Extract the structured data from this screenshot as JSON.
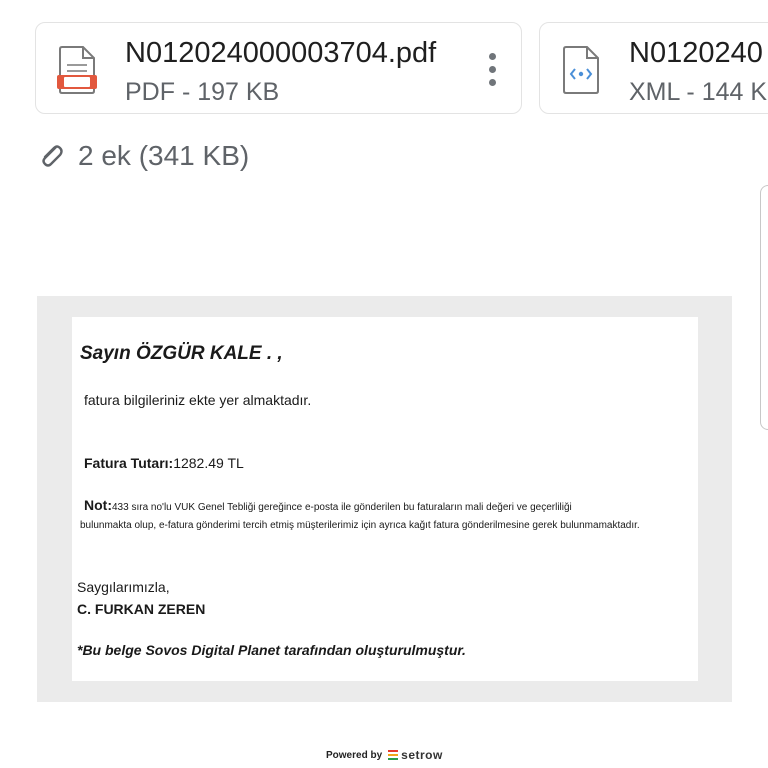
{
  "attachments": [
    {
      "name": "N012024000003704.pdf",
      "meta": "PDF - 197 KB",
      "icon": "pdf-file-icon"
    },
    {
      "name": "N0120240",
      "meta": "XML - 144 K",
      "icon": "xml-file-icon"
    }
  ],
  "attachment_summary": "2 ek (341 KB)",
  "email": {
    "greeting": "Sayın ÖZGÜR KALE . ,",
    "intro": "fatura bilgileriniz ekte yer almaktadır.",
    "amount_label": "Fatura Tutarı:",
    "amount_value": "1282.49 TL",
    "note_label": "Not:",
    "note_line1": "433 sıra no'lu VUK Genel Tebliği gereğince e-posta ile gönderilen bu faturaların mali değeri ve geçerliliği",
    "note_line2": "bulunmakta olup, e-fatura gönderimi tercih etmiş müşterilerimiz için ayrıca kağıt fatura gönderilmesine gerek bulunmamaktadır.",
    "regards": "Saygılarımızla,",
    "signer": "C. FURKAN ZEREN",
    "footer_note": "*Bu belge Sovos Digital Planet tarafından oluşturulmuştur."
  },
  "footer": {
    "powered_by": "Powered by",
    "brand": "setrow"
  },
  "colors": {
    "pdf_accent": "#e2583e",
    "xml_accent": "#4a8fd8",
    "muted_text": "#5f6368",
    "mail_bg": "#ebebeb"
  }
}
